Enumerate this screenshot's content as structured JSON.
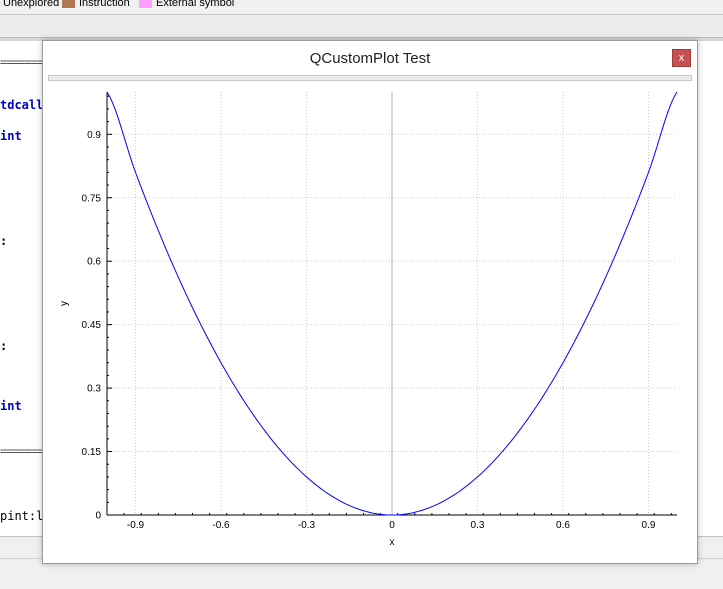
{
  "legend": {
    "items": [
      {
        "label": "Unexplored",
        "color": "#7a7a7a"
      },
      {
        "label": "Instruction",
        "color": "#b07850"
      },
      {
        "label": "External symbol",
        "color": "#ff9cff"
      }
    ]
  },
  "code": {
    "lines": [
      {
        "text": "=========",
        "style": "sep"
      },
      {
        "text": "tdcall",
        "style": "kw"
      },
      {
        "text": "int",
        "style": "kw"
      },
      {
        "text": ":",
        "style": "plain"
      },
      {
        "text": ":",
        "style": "plain"
      },
      {
        "text": "int",
        "style": "kw"
      },
      {
        "text": "=========",
        "style": "sep"
      },
      {
        "text": "pint:lo",
        "style": "plain"
      }
    ]
  },
  "dialog": {
    "title": "QCustomPlot Test",
    "close_label": "x"
  },
  "chart_data": {
    "type": "line",
    "xlabel": "x",
    "ylabel": "y",
    "xlim": [
      -1,
      1
    ],
    "ylim": [
      0,
      1
    ],
    "x_ticks": [
      "-0.9",
      "-0.6",
      "-0.3",
      "0",
      "0.3",
      "0.6",
      "0.9"
    ],
    "y_ticks": [
      "0",
      "0.15",
      "0.3",
      "0.45",
      "0.6",
      "0.75",
      "0.9"
    ],
    "grid": true,
    "line_color": "#0000ff",
    "series": [
      {
        "x": [
          -1.0,
          -0.9,
          -0.8,
          -0.7,
          -0.6,
          -0.5,
          -0.4,
          -0.3,
          -0.2,
          -0.1,
          0.0,
          0.1,
          0.2,
          0.3,
          0.4,
          0.5,
          0.6,
          0.7,
          0.8,
          0.9,
          1.0
        ],
        "values": [
          1.0,
          0.81,
          0.64,
          0.49,
          0.36,
          0.25,
          0.16,
          0.09,
          0.04,
          0.01,
          0.0,
          0.01,
          0.04,
          0.09,
          0.16,
          0.25,
          0.36,
          0.49,
          0.64,
          0.81,
          1.0
        ]
      }
    ]
  }
}
